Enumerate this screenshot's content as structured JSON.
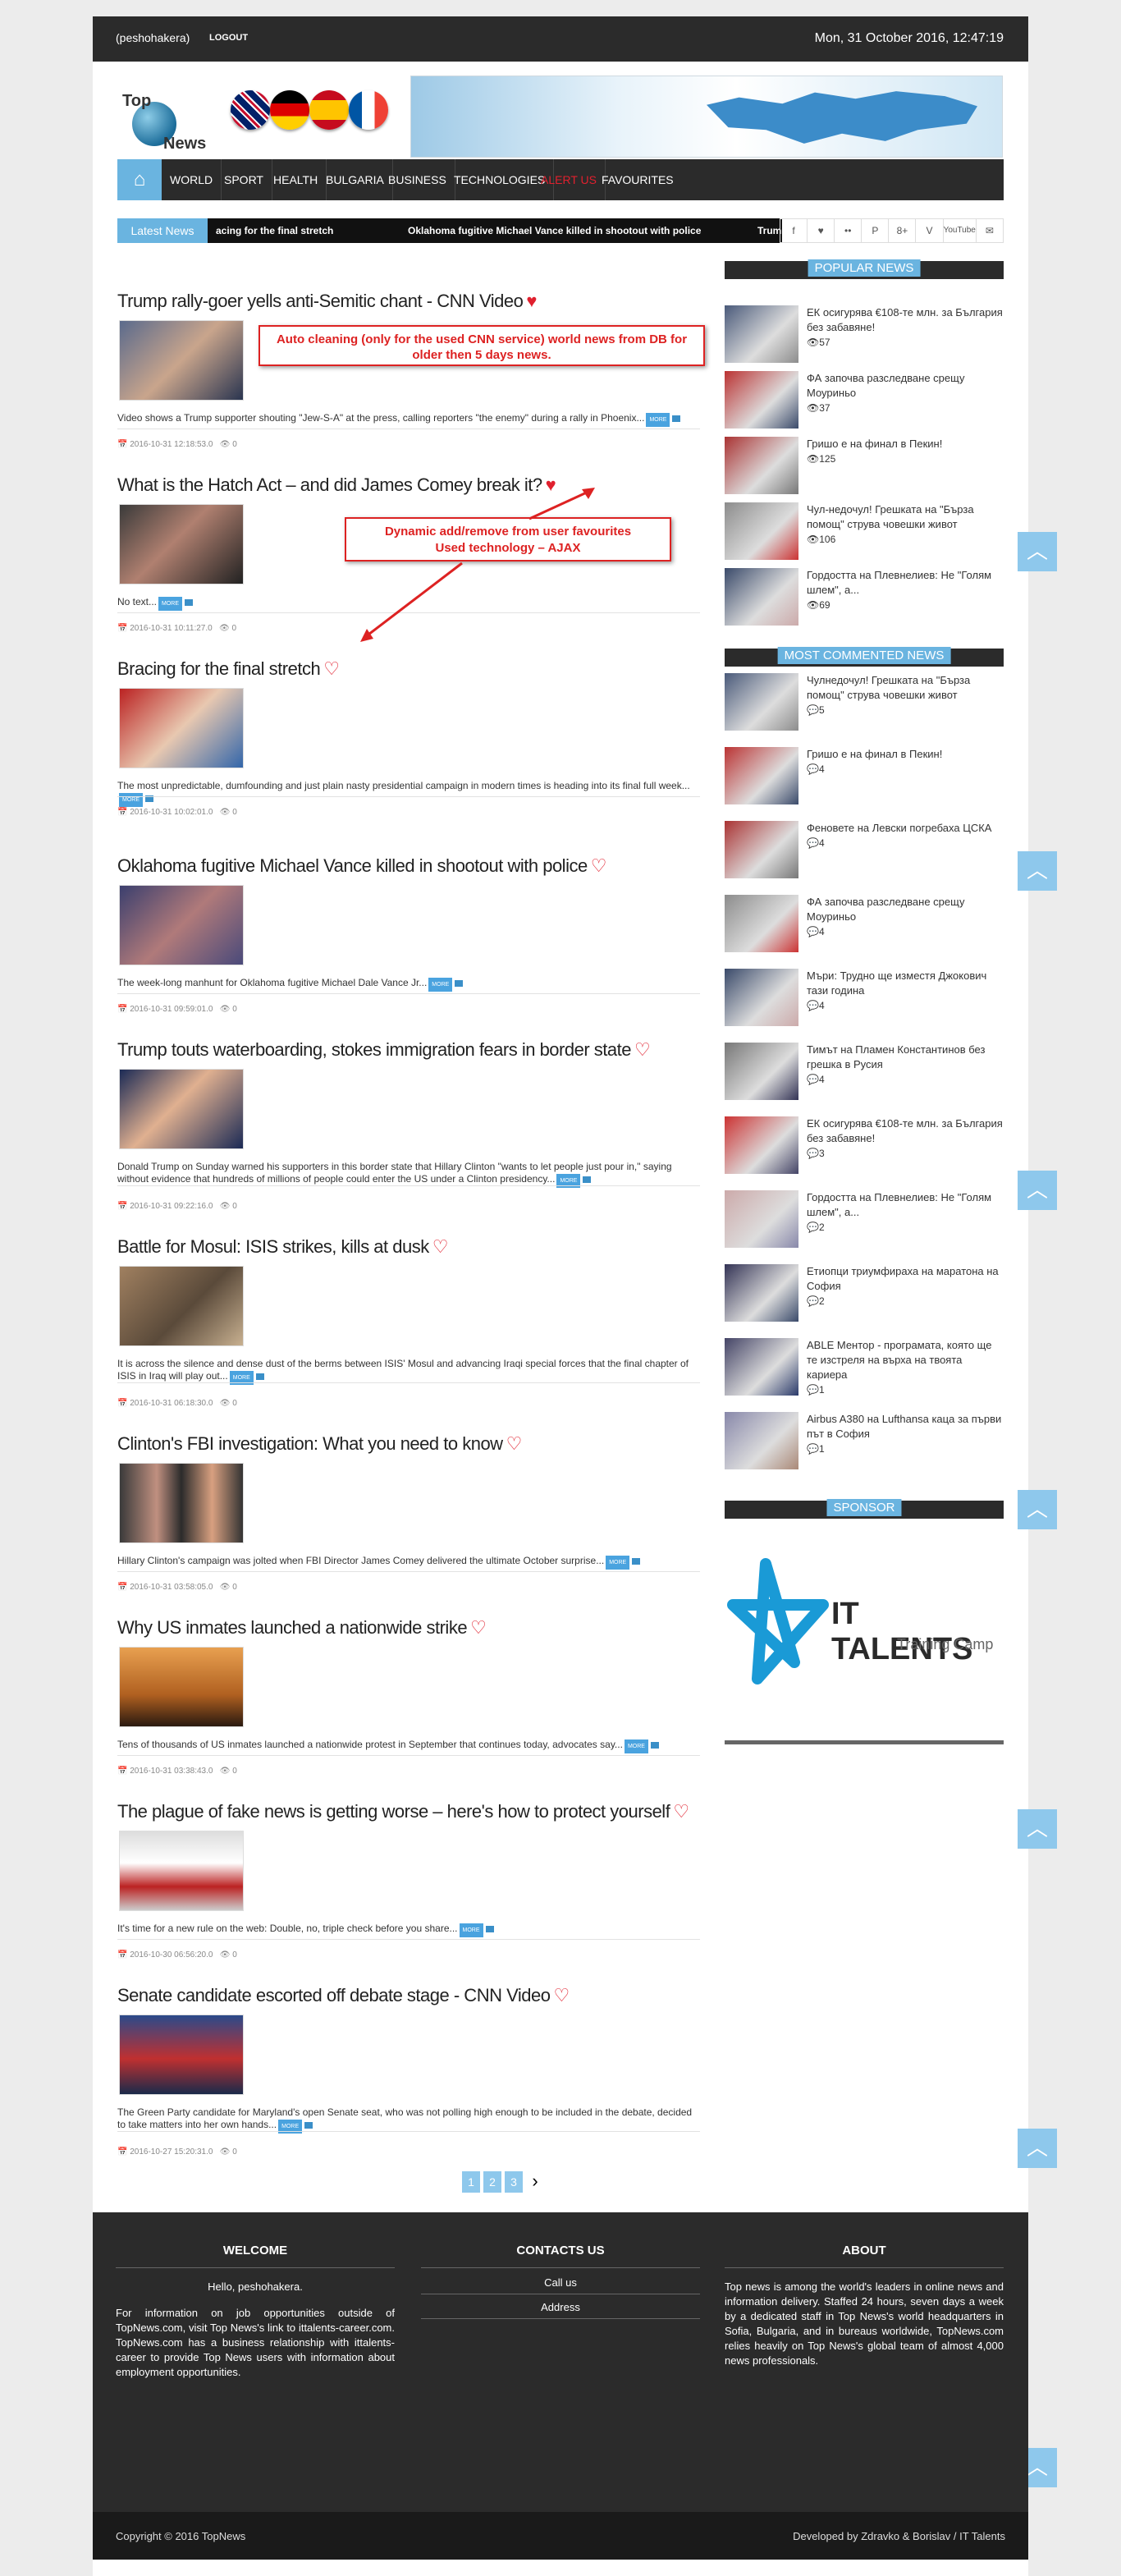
{
  "topbar": {
    "user": "(peshohakera)",
    "logout": "LOGOUT",
    "date": "Mon, 31 October 2016, 12:47:19"
  },
  "logo": {
    "top": "Top",
    "news": "News"
  },
  "nav": {
    "items": [
      "WORLD",
      "SPORT",
      "HEALTH",
      "BULGARIA",
      "BUSINESS",
      "TECHNOLOGIES",
      "ALERT US",
      "FAVOURITES"
    ]
  },
  "ticker": {
    "label": "Latest News",
    "item1": "acing for the final stretch",
    "item2": "Oklahoma fugitive Michael Vance killed in shootout with police",
    "item3": "Trump to"
  },
  "social": [
    "f",
    "♥",
    "••",
    "P",
    "8+",
    "V",
    "YouTube",
    "✉"
  ],
  "notes": {
    "cleaning": "Auto cleaning (only for the used CNN service) world news from DB for older then 5 days news.",
    "ajax_line1": "Dynamic add/remove from user favourites",
    "ajax_line2": "Used technology – AJAX"
  },
  "articles": [
    {
      "title": "Trump rally-goer yells anti-Semitic chant - CNN Video",
      "summary": "Video shows a Trump supporter shouting \"Jew-S-A\" at the press, calling reporters \"the enemy\" during a rally in Phoenix...",
      "date": "2016-10-31 12:18:53.0",
      "views": "0",
      "fav": true
    },
    {
      "title": "What is the Hatch Act – and did James Comey break it?",
      "summary": "No text...",
      "date": "2016-10-31 10:11:27.0",
      "views": "0",
      "fav": true
    },
    {
      "title": "Bracing for the final stretch",
      "summary": "The most unpredictable, dumfounding and just plain nasty presidential campaign in modern times is heading into its final full week...",
      "date": "2016-10-31 10:02:01.0",
      "views": "0",
      "fav": false
    },
    {
      "title": "Oklahoma fugitive Michael Vance killed in shootout with police",
      "summary": "The week-long manhunt for Oklahoma fugitive Michael Dale Vance Jr...",
      "date": "2016-10-31 09:59:01.0",
      "views": "0",
      "fav": false
    },
    {
      "title": "Trump touts waterboarding, stokes immigration fears in border state",
      "summary": "Donald Trump on Sunday warned his supporters in this border state that Hillary Clinton \"wants to let people just pour in,\" saying without evidence that hundreds of millions of people could enter the US under a Clinton presidency...",
      "date": "2016-10-31 09:22:16.0",
      "views": "0",
      "fav": false
    },
    {
      "title": "Battle for Mosul: ISIS strikes, kills at dusk",
      "summary": "It is across the silence and dense dust of the berms between ISIS' Mosul and advancing Iraqi special forces that the final chapter of ISIS in Iraq will play out...",
      "date": "2016-10-31 06:18:30.0",
      "views": "0",
      "fav": false
    },
    {
      "title": "Clinton's FBI investigation: What you need to know",
      "summary": "Hillary Clinton's campaign was jolted when FBI Director James Comey delivered the ultimate October surprise...",
      "date": "2016-10-31 03:58:05.0",
      "views": "0",
      "fav": false
    },
    {
      "title": "Why US inmates launched a nationwide strike",
      "summary": "Tens of thousands of US inmates launched a nationwide protest in September that continues today, advocates say...",
      "date": "2016-10-31 03:38:43.0",
      "views": "0",
      "fav": false
    },
    {
      "title": "The plague of fake news is getting worse – here's how to protect yourself",
      "summary": "It's time for a new rule on the web: Double, no, triple check before you share...",
      "date": "2016-10-30 06:56:20.0",
      "views": "0",
      "fav": false
    },
    {
      "title": "Senate candidate escorted off debate stage - CNN Video",
      "summary": "The Green Party candidate for Maryland's open Senate seat, who was not polling high enough to be included in the debate, decided to take matters into her own hands...",
      "date": "2016-10-27 15:20:31.0",
      "views": "0",
      "fav": false
    }
  ],
  "more_label": "MORE",
  "pager": [
    "1",
    "2",
    "3"
  ],
  "popular": {
    "heading": "POPULAR NEWS",
    "items": [
      {
        "text": "ЕК осигурява €108-те млн. за България без забавяне!",
        "count": "57"
      },
      {
        "text": "ФА започва разследване срещу Моуриньо",
        "count": "37"
      },
      {
        "text": "Гришо е на финал в Пекин!",
        "count": "125"
      },
      {
        "text": "Чул-недочул! Грешката на \"Бърза помощ\" струва човешки живот",
        "count": "106"
      },
      {
        "text": "Гордостта на Плевнелиев: Не \"Голям шлем\", а...",
        "count": "69"
      }
    ]
  },
  "commented": {
    "heading": "MOST COMMENTED NEWS",
    "items": [
      {
        "text": "Чулнедочул! Грешката на \"Бърза помощ\" струва човешки живот",
        "count": "5"
      },
      {
        "text": "Гришо е на финал в Пекин!",
        "count": "4"
      },
      {
        "text": "Феновете на Левски погребаха ЦСКА",
        "count": "4"
      },
      {
        "text": "ФА започва разследване срещу Моуриньо",
        "count": "4"
      },
      {
        "text": "Мъри: Трудно ще изместя Джокович тази година",
        "count": "4"
      },
      {
        "text": "Тимът на Пламен Константинов без грешка в Русия",
        "count": "4"
      },
      {
        "text": "ЕК осигурява €108-те млн. за България без забавяне!",
        "count": "3"
      },
      {
        "text": "Гордостта на Плевнелиев: Не \"Голям шлем\", а...",
        "count": "2"
      },
      {
        "text": "Етиопци триумфираха на маратона на София",
        "count": "2"
      },
      {
        "text": "ABLE Ментор - програмата, която ще те изстреля на върха на твоята кариера",
        "count": "1"
      },
      {
        "text": "Airbus A380 на Lufthansa каца за първи път в София",
        "count": "1"
      }
    ]
  },
  "sponsor": {
    "heading": "SPONSOR",
    "brand": "IT TALENTS",
    "tagline": "Training Camp"
  },
  "footer": {
    "welcome_title": "WELCOME",
    "welcome_hello": "Hello, peshohakera.",
    "welcome_text": "For information on job opportunities outside of TopNews.com, visit Top News's link to ittalents-career.com. TopNews.com has a business relationship with ittalents-career to provide Top News users with information about employment opportunities.",
    "contacts_title": "CONTACTS US",
    "call_us": "Call us",
    "address": "Address",
    "about_title": "ABOUT",
    "about_text": "Top news is among the world's leaders in online news and information delivery. Staffed 24 hours, seven days a week by a dedicated staff in Top News's world headquarters in Sofia, Bulgaria, and in bureaus worldwide, TopNews.com relies heavily on Top News's global team of almost 4,000 news professionals."
  },
  "copyright": "Copyright © 2016 TopNews",
  "developed": "Developed by Zdravko & Borislav / IT Talents"
}
